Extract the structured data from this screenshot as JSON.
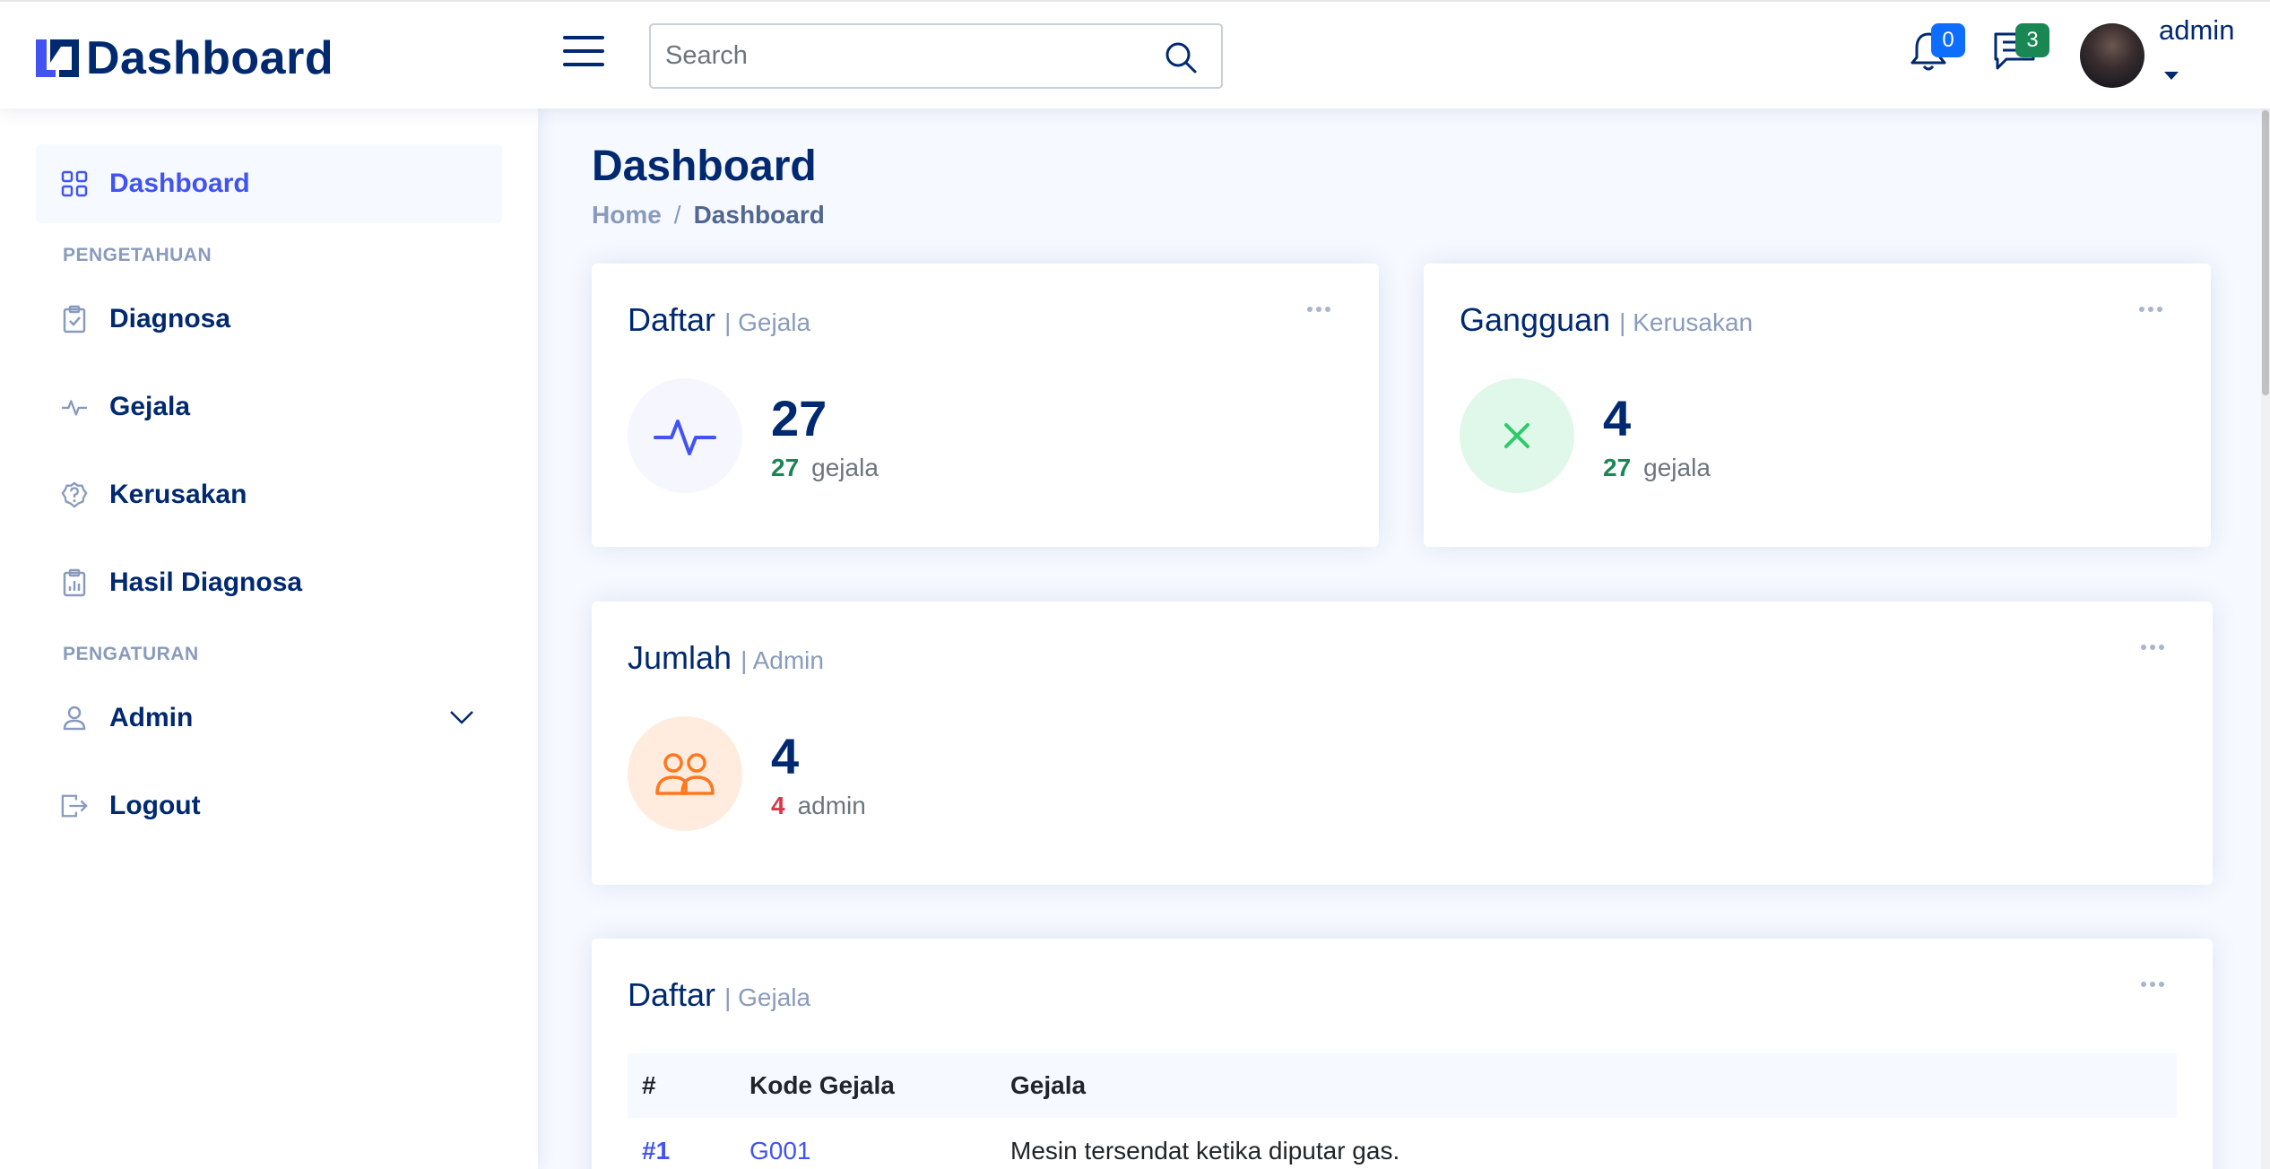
{
  "header": {
    "brand": "Dashboard",
    "search_placeholder": "Search",
    "notifications_count": "0",
    "messages_count": "3",
    "username": "admin"
  },
  "sidebar": {
    "items": [
      {
        "label": "Dashboard",
        "icon": "grid-icon",
        "active": true
      },
      {
        "label": "Diagnosa",
        "icon": "clipboard-check-icon"
      },
      {
        "label": "Gejala",
        "icon": "activity-icon"
      },
      {
        "label": "Kerusakan",
        "icon": "question-badge-icon"
      },
      {
        "label": "Hasil Diagnosa",
        "icon": "clipboard-data-icon"
      },
      {
        "label": "Admin",
        "icon": "person-icon"
      },
      {
        "label": "Logout",
        "icon": "box-arrow-right-icon"
      }
    ],
    "headings": [
      "Pengetahuan",
      "Pengaturan"
    ]
  },
  "main": {
    "page_title": "Dashboard",
    "breadcrumb": [
      "Home",
      "Dashboard"
    ],
    "cards": [
      {
        "title": "Daftar",
        "subtitle": "| Gejala",
        "value": "27",
        "foot_num": "27",
        "foot_label": "gejala",
        "icon": "activity-icon",
        "circle_color": "#f6f6fe",
        "icon_color": "#4154f1"
      },
      {
        "title": "Gangguan",
        "subtitle": "| Kerusakan",
        "value": "4",
        "foot_num": "27",
        "foot_label": "gejala",
        "icon": "x-icon",
        "circle_color": "#e0f8e9",
        "icon_color": "#2eca6a"
      },
      {
        "title": "Jumlah",
        "subtitle": "| Admin",
        "value": "4",
        "foot_num": "4",
        "foot_label": "admin",
        "icon": "people-icon",
        "circle_color": "#ffecdf",
        "icon_color": "#ff771d"
      }
    ],
    "table_card": {
      "title": "Daftar",
      "subtitle": "| Gejala",
      "columns": [
        "#",
        "Kode Gejala",
        "Gejala"
      ],
      "rows": [
        {
          "rank": "#1",
          "code": "G001",
          "name": "Mesin tersendat ketika diputar gas."
        }
      ]
    }
  },
  "colors": {
    "primary": "#012970",
    "accent": "#4154f1",
    "muted": "#899bbd",
    "background": "#f6f9ff"
  }
}
